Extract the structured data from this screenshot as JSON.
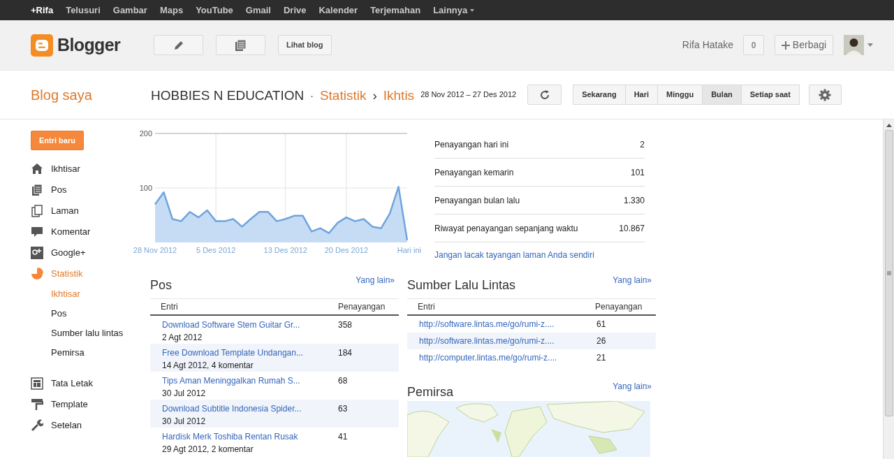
{
  "topbar": {
    "items": [
      {
        "label": "+Rifa",
        "selected": true
      },
      {
        "label": "Telusuri",
        "selected": false
      },
      {
        "label": "Gambar",
        "selected": false
      },
      {
        "label": "Maps",
        "selected": false
      },
      {
        "label": "YouTube",
        "selected": false
      },
      {
        "label": "Gmail",
        "selected": false
      },
      {
        "label": "Drive",
        "selected": false
      },
      {
        "label": "Kalender",
        "selected": false
      },
      {
        "label": "Terjemahan",
        "selected": false
      },
      {
        "label": "Lainnya",
        "selected": false,
        "dropdown": true
      }
    ]
  },
  "header": {
    "logo": "Blogger",
    "view_blog": "Lihat blog",
    "user": "Rifa Hatake",
    "notifications": "0",
    "share": "Berbagi"
  },
  "subheader": {
    "my_blogs": "Blog saya",
    "blog_title": "HOBBIES N EDUCATION",
    "separator": "·",
    "section": "Statistik",
    "arrow": "›",
    "page": "Ikhtis",
    "date_range": "28 Nov 2012 – 27 Des 2012",
    "ranges": [
      {
        "label": "Sekarang",
        "selected": false
      },
      {
        "label": "Hari",
        "selected": false
      },
      {
        "label": "Minggu",
        "selected": false
      },
      {
        "label": "Bulan",
        "selected": true
      },
      {
        "label": "Setiap saat",
        "selected": false
      }
    ]
  },
  "sidebar": {
    "new_post": "Entri baru",
    "items": [
      {
        "label": "Ikhtisar",
        "selected": false
      },
      {
        "label": "Pos",
        "selected": false
      },
      {
        "label": "Laman",
        "selected": false
      },
      {
        "label": "Komentar",
        "selected": false
      },
      {
        "label": "Google+",
        "selected": false
      },
      {
        "label": "Statistik",
        "selected": true,
        "children": [
          {
            "label": "Ikhtisar",
            "selected": true
          },
          {
            "label": "Pos",
            "selected": false
          },
          {
            "label": "Sumber lalu lintas",
            "selected": false
          },
          {
            "label": "Pemirsa",
            "selected": false
          }
        ]
      },
      {
        "label": "Tata Letak",
        "selected": false
      },
      {
        "label": "Template",
        "selected": false
      },
      {
        "label": "Setelan",
        "selected": false
      }
    ]
  },
  "chart_data": {
    "type": "area",
    "categories": [
      "28 Nov 2012",
      null,
      null,
      null,
      null,
      null,
      null,
      "5 Des 2012",
      null,
      null,
      null,
      null,
      null,
      null,
      null,
      "13 Des 2012",
      null,
      null,
      null,
      null,
      null,
      null,
      "20 Des 2012",
      null,
      null,
      null,
      null,
      null,
      null,
      "Hari ini"
    ],
    "values": [
      70,
      92,
      43,
      39,
      56,
      46,
      59,
      39,
      39,
      43,
      29,
      43,
      56,
      56,
      39,
      43,
      49,
      49,
      20,
      26,
      17,
      36,
      46,
      39,
      43,
      29,
      26,
      53,
      102,
      4
    ],
    "ylim": [
      0,
      200
    ],
    "yticks": [
      100,
      200
    ],
    "grid": true
  },
  "stats": {
    "rows": [
      {
        "label": "Penayangan hari ini",
        "value": "2"
      },
      {
        "label": "Penayangan kemarin",
        "value": "101"
      },
      {
        "label": "Penayangan bulan lalu",
        "value": "1.330"
      },
      {
        "label": "Riwayat penayangan sepanjang waktu",
        "value": "10.867"
      }
    ],
    "link": "Jangan lacak tayangan laman Anda sendiri"
  },
  "posts": {
    "title": "Pos",
    "more": "Yang lain»",
    "columns": [
      "Entri",
      "Penayangan"
    ],
    "rows": [
      {
        "title": "Download Software Stem Guitar Gr...",
        "meta": "2 Agt 2012",
        "views": "358"
      },
      {
        "title": "Free Download Template Undangan...",
        "meta": "14 Agt 2012, 4 komentar",
        "views": "184"
      },
      {
        "title": "Tips Aman Meninggalkan Rumah S...",
        "meta": "30 Jul 2012",
        "views": "68"
      },
      {
        "title": "Download Subtitle Indonesia Spider...",
        "meta": "30 Jul 2012",
        "views": "63"
      },
      {
        "title": "Hardisk Merk Toshiba Rentan Rusak",
        "meta": "29 Agt 2012, 2 komentar",
        "views": "41"
      }
    ]
  },
  "traffic": {
    "title": "Sumber Lalu Lintas",
    "more": "Yang lain»",
    "columns": [
      "Entri",
      "Penayangan"
    ],
    "rows": [
      {
        "url": "http://software.lintas.me/go/rumi-z....",
        "views": "61"
      },
      {
        "url": "http://software.lintas.me/go/rumi-z....",
        "views": "26"
      },
      {
        "url": "http://computer.lintas.me/go/rumi-z....",
        "views": "21"
      }
    ]
  },
  "audience": {
    "title": "Pemirsa",
    "more": "Yang lain»"
  }
}
